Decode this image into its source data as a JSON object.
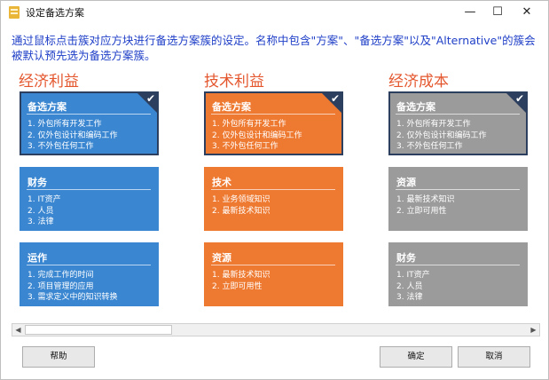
{
  "window": {
    "title": "设定备选方案",
    "minimize": "—",
    "maximize": "☐",
    "close": "✕"
  },
  "intro": "通过鼠标点击簇对应方块进行备选方案簇的设定。名称中包含\"方案\"、\"备选方案\"以及\"Alternative\"的簇会被默认预先选为备选方案簇。",
  "columns": [
    {
      "title": "经济利益",
      "cards": [
        {
          "title": "备选方案",
          "items": [
            "1. 外包所有开发工作",
            "2. 仅外包设计和编码工作",
            "3. 不外包任何工作"
          ],
          "selected": true
        },
        {
          "title": "财务",
          "items": [
            "1. IT资产",
            "2. 人员",
            "3. 法律"
          ]
        },
        {
          "title": "运作",
          "items": [
            "1. 完成工作的时间",
            "2. 项目管理的应用",
            "3. 需求定义中的知识转换"
          ]
        }
      ]
    },
    {
      "title": "技术利益",
      "cards": [
        {
          "title": "备选方案",
          "items": [
            "1. 外包所有开发工作",
            "2. 仅外包设计和编码工作",
            "3. 不外包任何工作"
          ],
          "selected": true
        },
        {
          "title": "技术",
          "items": [
            "1. 业务领域知识",
            "2. 最新技术知识"
          ]
        },
        {
          "title": "资源",
          "items": [
            "1. 最新技术知识",
            "2. 立即可用性"
          ]
        }
      ]
    },
    {
      "title": "经济成本",
      "cards": [
        {
          "title": "备选方案",
          "items": [
            "1. 外包所有开发工作",
            "2. 仅外包设计和编码工作",
            "3. 不外包任何工作"
          ],
          "selected": true
        },
        {
          "title": "资源",
          "items": [
            "1. 最新技术知识",
            "2. 立即可用性"
          ]
        },
        {
          "title": "财务",
          "items": [
            "1. IT资产",
            "2. 人员",
            "3. 法律"
          ]
        }
      ]
    }
  ],
  "check_mark": "✔",
  "scroll": {
    "left_arrow": "◀",
    "right_arrow": "▶"
  },
  "buttons": {
    "help": "帮助",
    "ok": "确定",
    "cancel": "取消"
  },
  "colors": {
    "blue": "#3a86d1",
    "orange": "#ee7a32",
    "gray": "#9b9b9b",
    "header": "#e4572e",
    "intro": "#1f3fc7"
  }
}
